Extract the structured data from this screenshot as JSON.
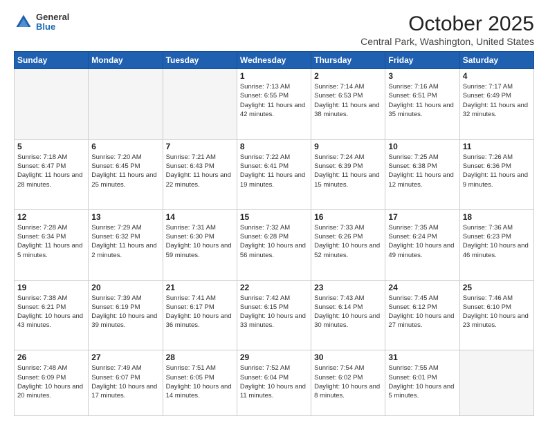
{
  "header": {
    "logo_general": "General",
    "logo_blue": "Blue",
    "month_title": "October 2025",
    "location": "Central Park, Washington, United States"
  },
  "days_of_week": [
    "Sunday",
    "Monday",
    "Tuesday",
    "Wednesday",
    "Thursday",
    "Friday",
    "Saturday"
  ],
  "weeks": [
    [
      {
        "day": "",
        "info": ""
      },
      {
        "day": "",
        "info": ""
      },
      {
        "day": "",
        "info": ""
      },
      {
        "day": "1",
        "info": "Sunrise: 7:13 AM\nSunset: 6:55 PM\nDaylight: 11 hours\nand 42 minutes."
      },
      {
        "day": "2",
        "info": "Sunrise: 7:14 AM\nSunset: 6:53 PM\nDaylight: 11 hours\nand 38 minutes."
      },
      {
        "day": "3",
        "info": "Sunrise: 7:16 AM\nSunset: 6:51 PM\nDaylight: 11 hours\nand 35 minutes."
      },
      {
        "day": "4",
        "info": "Sunrise: 7:17 AM\nSunset: 6:49 PM\nDaylight: 11 hours\nand 32 minutes."
      }
    ],
    [
      {
        "day": "5",
        "info": "Sunrise: 7:18 AM\nSunset: 6:47 PM\nDaylight: 11 hours\nand 28 minutes."
      },
      {
        "day": "6",
        "info": "Sunrise: 7:20 AM\nSunset: 6:45 PM\nDaylight: 11 hours\nand 25 minutes."
      },
      {
        "day": "7",
        "info": "Sunrise: 7:21 AM\nSunset: 6:43 PM\nDaylight: 11 hours\nand 22 minutes."
      },
      {
        "day": "8",
        "info": "Sunrise: 7:22 AM\nSunset: 6:41 PM\nDaylight: 11 hours\nand 19 minutes."
      },
      {
        "day": "9",
        "info": "Sunrise: 7:24 AM\nSunset: 6:39 PM\nDaylight: 11 hours\nand 15 minutes."
      },
      {
        "day": "10",
        "info": "Sunrise: 7:25 AM\nSunset: 6:38 PM\nDaylight: 11 hours\nand 12 minutes."
      },
      {
        "day": "11",
        "info": "Sunrise: 7:26 AM\nSunset: 6:36 PM\nDaylight: 11 hours\nand 9 minutes."
      }
    ],
    [
      {
        "day": "12",
        "info": "Sunrise: 7:28 AM\nSunset: 6:34 PM\nDaylight: 11 hours\nand 5 minutes."
      },
      {
        "day": "13",
        "info": "Sunrise: 7:29 AM\nSunset: 6:32 PM\nDaylight: 11 hours\nand 2 minutes."
      },
      {
        "day": "14",
        "info": "Sunrise: 7:31 AM\nSunset: 6:30 PM\nDaylight: 10 hours\nand 59 minutes."
      },
      {
        "day": "15",
        "info": "Sunrise: 7:32 AM\nSunset: 6:28 PM\nDaylight: 10 hours\nand 56 minutes."
      },
      {
        "day": "16",
        "info": "Sunrise: 7:33 AM\nSunset: 6:26 PM\nDaylight: 10 hours\nand 52 minutes."
      },
      {
        "day": "17",
        "info": "Sunrise: 7:35 AM\nSunset: 6:24 PM\nDaylight: 10 hours\nand 49 minutes."
      },
      {
        "day": "18",
        "info": "Sunrise: 7:36 AM\nSunset: 6:23 PM\nDaylight: 10 hours\nand 46 minutes."
      }
    ],
    [
      {
        "day": "19",
        "info": "Sunrise: 7:38 AM\nSunset: 6:21 PM\nDaylight: 10 hours\nand 43 minutes."
      },
      {
        "day": "20",
        "info": "Sunrise: 7:39 AM\nSunset: 6:19 PM\nDaylight: 10 hours\nand 39 minutes."
      },
      {
        "day": "21",
        "info": "Sunrise: 7:41 AM\nSunset: 6:17 PM\nDaylight: 10 hours\nand 36 minutes."
      },
      {
        "day": "22",
        "info": "Sunrise: 7:42 AM\nSunset: 6:15 PM\nDaylight: 10 hours\nand 33 minutes."
      },
      {
        "day": "23",
        "info": "Sunrise: 7:43 AM\nSunset: 6:14 PM\nDaylight: 10 hours\nand 30 minutes."
      },
      {
        "day": "24",
        "info": "Sunrise: 7:45 AM\nSunset: 6:12 PM\nDaylight: 10 hours\nand 27 minutes."
      },
      {
        "day": "25",
        "info": "Sunrise: 7:46 AM\nSunset: 6:10 PM\nDaylight: 10 hours\nand 23 minutes."
      }
    ],
    [
      {
        "day": "26",
        "info": "Sunrise: 7:48 AM\nSunset: 6:09 PM\nDaylight: 10 hours\nand 20 minutes."
      },
      {
        "day": "27",
        "info": "Sunrise: 7:49 AM\nSunset: 6:07 PM\nDaylight: 10 hours\nand 17 minutes."
      },
      {
        "day": "28",
        "info": "Sunrise: 7:51 AM\nSunset: 6:05 PM\nDaylight: 10 hours\nand 14 minutes."
      },
      {
        "day": "29",
        "info": "Sunrise: 7:52 AM\nSunset: 6:04 PM\nDaylight: 10 hours\nand 11 minutes."
      },
      {
        "day": "30",
        "info": "Sunrise: 7:54 AM\nSunset: 6:02 PM\nDaylight: 10 hours\nand 8 minutes."
      },
      {
        "day": "31",
        "info": "Sunrise: 7:55 AM\nSunset: 6:01 PM\nDaylight: 10 hours\nand 5 minutes."
      },
      {
        "day": "",
        "info": ""
      }
    ]
  ]
}
